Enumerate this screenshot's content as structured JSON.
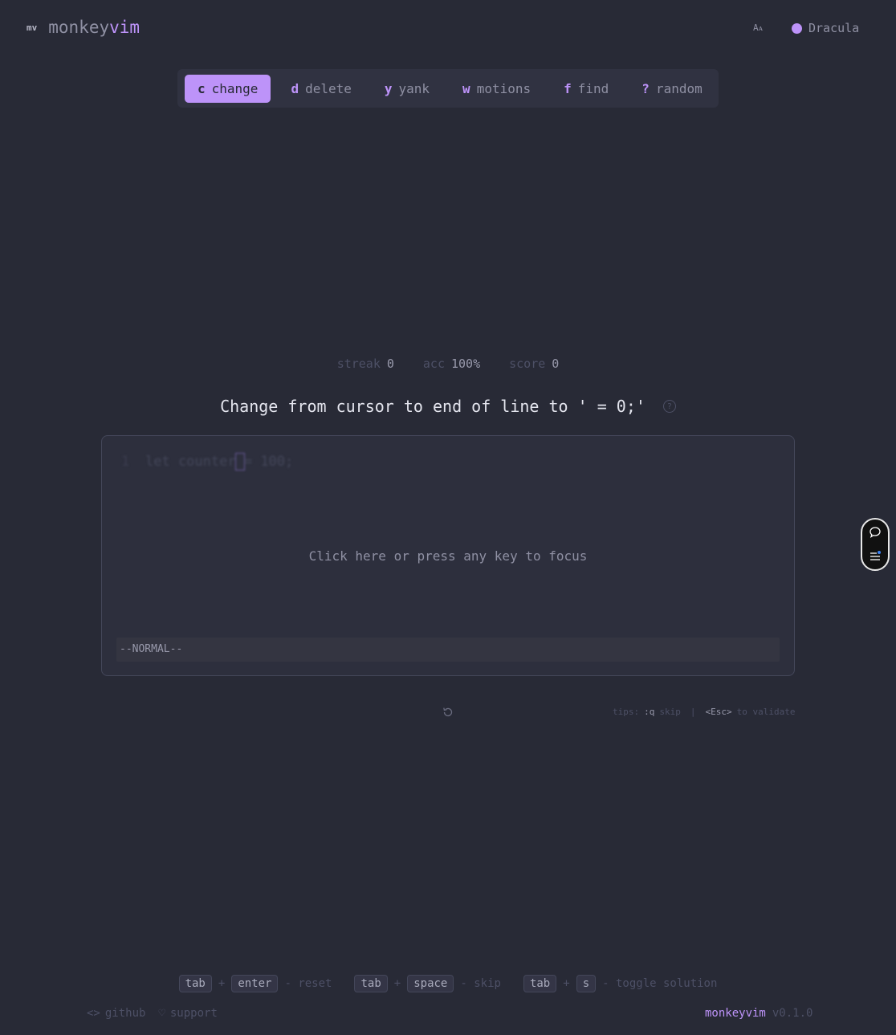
{
  "header": {
    "logo_mark": "mv",
    "logo_text_a": "monkey",
    "logo_text_b": "vim",
    "font_toggle": "Aᴀ",
    "theme_name": "Dracula",
    "accent_color": "#bd93f9"
  },
  "tabs": [
    {
      "key": "c",
      "label": "change",
      "active": true
    },
    {
      "key": "d",
      "label": "delete",
      "active": false
    },
    {
      "key": "y",
      "label": "yank",
      "active": false
    },
    {
      "key": "w",
      "label": "motions",
      "active": false
    },
    {
      "key": "f",
      "label": "find",
      "active": false
    },
    {
      "key": "?",
      "label": "random",
      "active": false
    }
  ],
  "stats": {
    "streak_label": "streak",
    "streak_value": "0",
    "acc_label": "acc",
    "acc_value": "100%",
    "score_label": "score",
    "score_value": "0"
  },
  "prompt": {
    "text": "Change from cursor to end of line to ' = 0;'",
    "help_icon": "?"
  },
  "editor": {
    "line_number": "1",
    "code_before": "let counter",
    "code_cursor": " ",
    "code_after": "= 100;",
    "focus_hint": "Click here or press any key to focus",
    "mode": "--NORMAL--"
  },
  "tips": {
    "prefix": "tips:",
    "skip_key": ":q",
    "skip_label": "skip",
    "sep": "|",
    "validate_key": "<Esc>",
    "validate_label": "to validate"
  },
  "shortcuts": [
    {
      "k1": "tab",
      "k2": "enter",
      "desc": "- reset"
    },
    {
      "k1": "tab",
      "k2": "space",
      "desc": "- skip"
    },
    {
      "k1": "tab",
      "k2": "s",
      "desc": "- toggle solution"
    }
  ],
  "footer": {
    "github": "github",
    "support": "support",
    "brand": "monkeyvim",
    "version": "v0.1.0"
  }
}
